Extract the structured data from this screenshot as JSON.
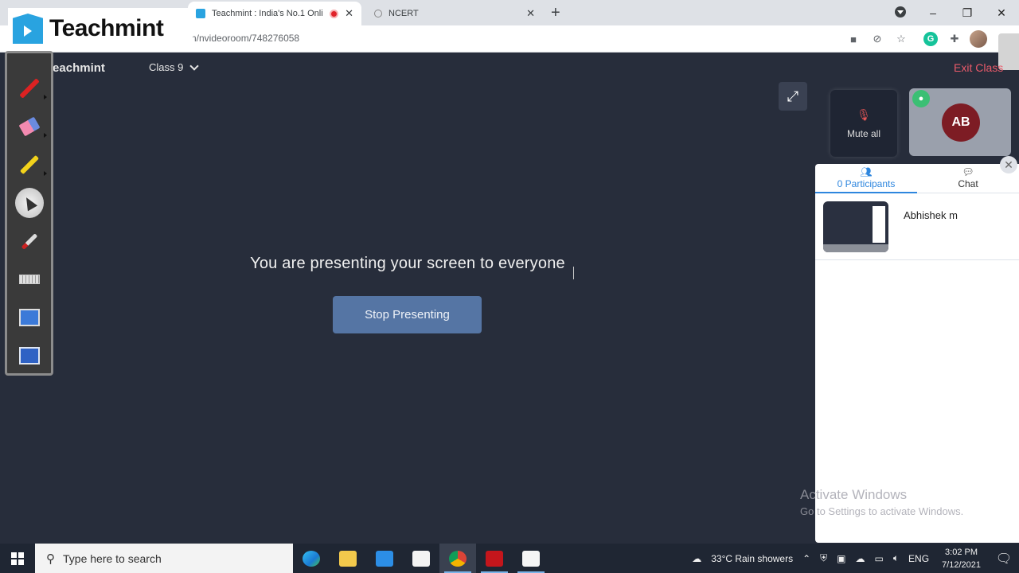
{
  "browser": {
    "tabs": [
      {
        "title": "Teachmint : India's No.1 Onli",
        "favicon": "teachmint-icon",
        "recording": true,
        "active": true
      },
      {
        "title": "NCERT",
        "favicon": "globe-icon",
        "active": false
      }
    ],
    "new_tab_label": "+",
    "url": "n/nvideoroom/748276058",
    "toolbar_icons": [
      "camera-icon",
      "eye-off-icon",
      "star-icon",
      "grammarly-icon",
      "extensions-icon",
      "profile-avatar"
    ],
    "window_controls": {
      "minimize": "–",
      "restore": "❐",
      "close": "✕"
    }
  },
  "logo_overlay": {
    "text": "Teachmint"
  },
  "app_header": {
    "brand": "Teachmint",
    "class_select": "Class 9",
    "exit_label": "Exit Class"
  },
  "draw_tools": [
    {
      "name": "pen-tool",
      "has_submenu": true
    },
    {
      "name": "eraser-tool",
      "has_submenu": true
    },
    {
      "name": "highlighter-tool",
      "has_submenu": true
    },
    {
      "name": "pointer-tool",
      "selected": true
    },
    {
      "name": "laser-pointer-tool"
    },
    {
      "name": "keyboard-tool"
    },
    {
      "name": "screen-capture-tool"
    },
    {
      "name": "screen-switch-tool"
    }
  ],
  "main": {
    "message": "You are presenting your screen to everyone",
    "stop_button": "Stop Presenting"
  },
  "tiles": {
    "mute_all_label": "Mute all",
    "user_initials": "AB"
  },
  "side_panel": {
    "tabs": [
      {
        "label": "0 Participants",
        "icon": "participants-icon",
        "active": true
      },
      {
        "label": "Chat",
        "icon": "chat-icon",
        "active": false
      }
    ],
    "participants": [
      {
        "name": "Abhishek m"
      }
    ]
  },
  "watermark": {
    "title": "Activate Windows",
    "subtitle": "Go to Settings to activate Windows."
  },
  "taskbar": {
    "search_placeholder": "Type here to search",
    "apps": [
      "edge",
      "file-explorer",
      "mail",
      "store",
      "chrome",
      "acrobat",
      "whiteboard"
    ],
    "weather": "33°C  Rain showers",
    "language": "ENG",
    "time": "3:02 PM",
    "date": "7/12/2021"
  }
}
